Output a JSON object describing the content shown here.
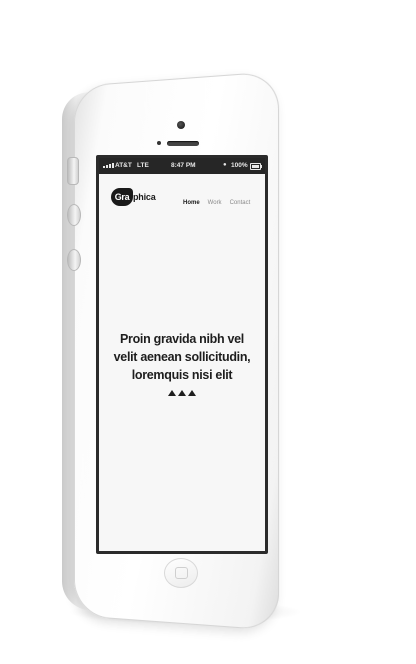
{
  "statusbar": {
    "carrier": "AT&T",
    "network": "LTE",
    "time": "8:47 PM",
    "battery": "100%",
    "lock_icon": "lock-icon",
    "signal_icon": "signal-bars-icon",
    "battery_icon": "battery-icon"
  },
  "header": {
    "logo_badge": "Gra",
    "logo_rest": "phica"
  },
  "nav": {
    "items": [
      {
        "label": "Home"
      },
      {
        "label": "Work"
      },
      {
        "label": "Contact"
      }
    ]
  },
  "hero": {
    "lines": [
      "Proin gravida nibh vel",
      "velit aenean sollicitudin,",
      "loremquis nisi elit"
    ]
  },
  "colors": {
    "screen_bg": "#f7f7f7",
    "statusbar_bg": "#262626",
    "text_dark": "#1e1e1e",
    "nav_inactive": "#8a8a8a"
  }
}
